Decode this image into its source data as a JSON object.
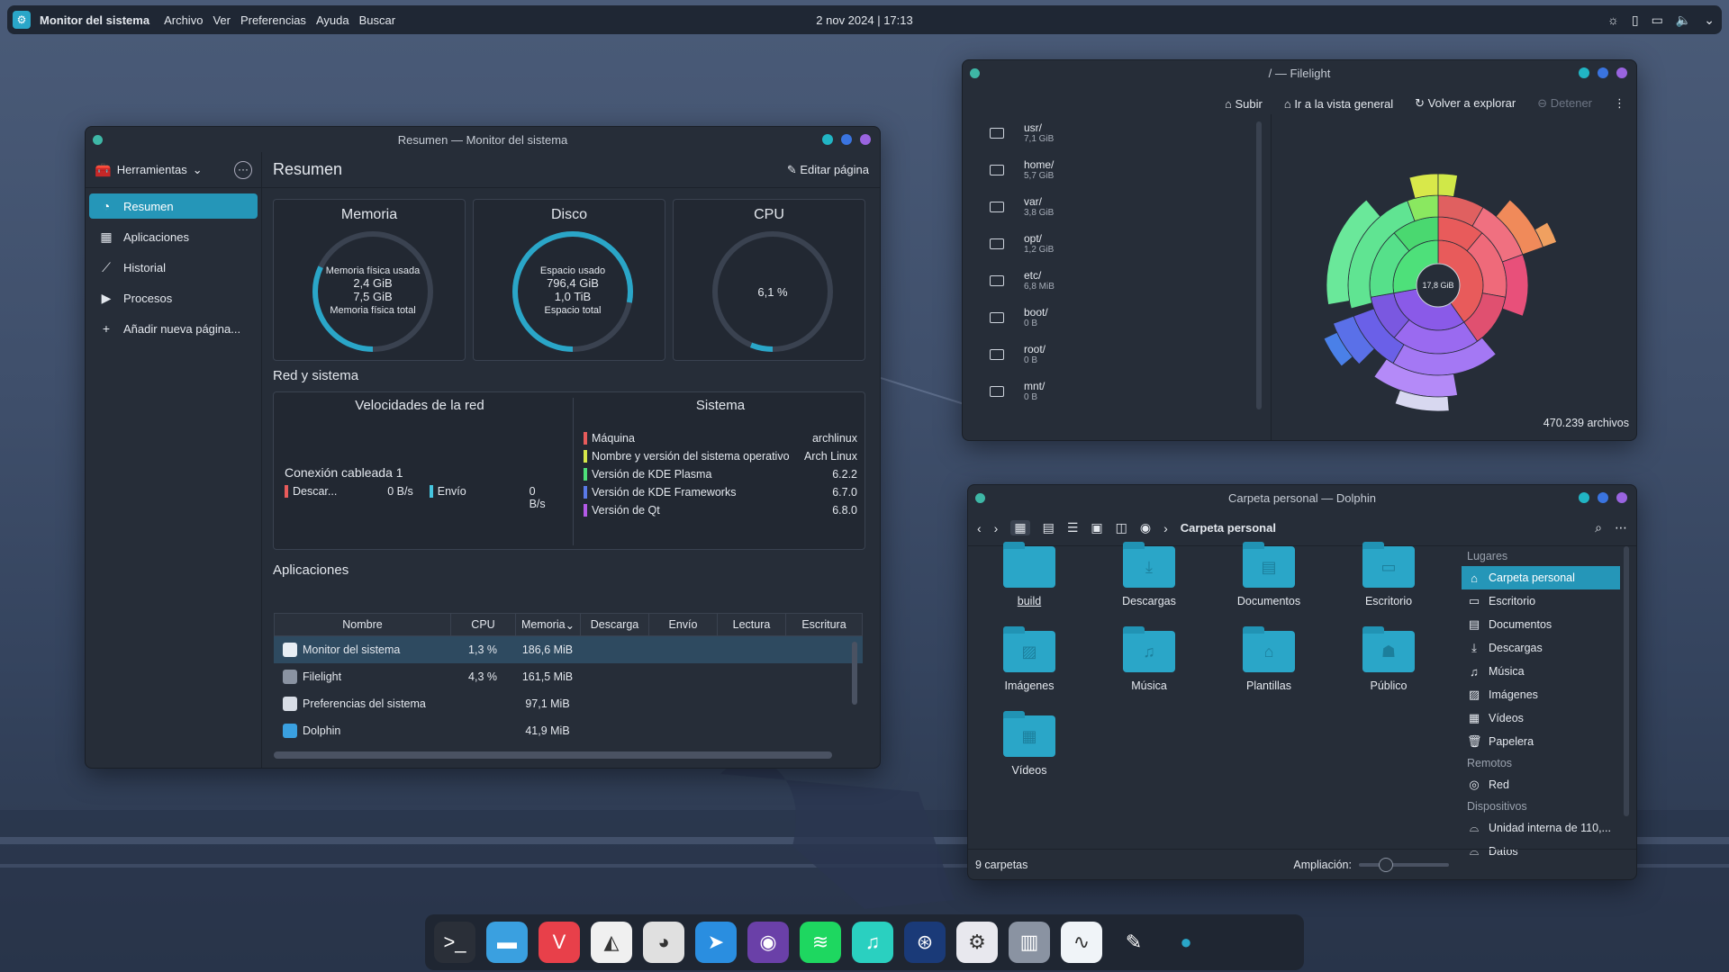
{
  "panel": {
    "app_name": "Monitor del sistema",
    "menu": [
      "Archivo",
      "Ver",
      "Preferencias",
      "Ayuda",
      "Buscar"
    ],
    "clock": "2 nov 2024 | 17:13"
  },
  "sysmon": {
    "title": "Resumen — Monitor del sistema",
    "tools_label": "Herramientas",
    "nav": [
      {
        "label": "Resumen",
        "icon": "gauge-icon"
      },
      {
        "label": "Aplicaciones",
        "icon": "grid-icon"
      },
      {
        "label": "Historial",
        "icon": "chart-icon"
      },
      {
        "label": "Procesos",
        "icon": "play-icon"
      },
      {
        "label": "Añadir nueva página...",
        "icon": "plus-icon"
      }
    ],
    "page_title": "Resumen",
    "edit_label": "Editar página",
    "memory": {
      "title": "Memoria",
      "used_label": "Memoria física usada",
      "used": "2,4 GiB",
      "total": "7,5 GiB",
      "total_label": "Memoria física total",
      "fraction": 0.32
    },
    "disk": {
      "title": "Disco",
      "used_label": "Espacio usado",
      "used": "796,4 GiB",
      "total": "1,0 TiB",
      "total_label": "Espacio total",
      "fraction": 0.78
    },
    "cpu": {
      "title": "CPU",
      "value": "6,1 %",
      "fraction": 0.061
    },
    "net_section": "Red y sistema",
    "net": {
      "title": "Velocidades de la red",
      "conn": "Conexión cableada 1",
      "down_label": "Descar...",
      "down_val": "0 B/s",
      "up_label": "Envío",
      "up_val": "0 B/s",
      "down_color": "#e85b5b",
      "up_color": "#46c6e0"
    },
    "system": {
      "title": "Sistema",
      "rows": [
        {
          "k": "Máquina",
          "v": "archlinux",
          "c": "#e85b5b"
        },
        {
          "k": "Nombre y versión del sistema operativo",
          "v": "Arch Linux",
          "c": "#d7e84a"
        },
        {
          "k": "Versión de KDE Plasma",
          "v": "6.2.2",
          "c": "#4ee07a"
        },
        {
          "k": "Versión de KDE Frameworks",
          "v": "6.7.0",
          "c": "#5a7ae8"
        },
        {
          "k": "Versión de Qt",
          "v": "6.8.0",
          "c": "#b45ae8"
        }
      ]
    },
    "apps_section": "Aplicaciones",
    "columns": [
      "Nombre",
      "CPU",
      "Memoria",
      "Descarga",
      "Envío",
      "Lectura",
      "Escritura"
    ],
    "rows": [
      {
        "name": "Monitor del sistema",
        "cpu": "1,3 %",
        "mem": "186,6 MiB"
      },
      {
        "name": "Filelight",
        "cpu": "4,3 %",
        "mem": "161,5 MiB"
      },
      {
        "name": "Preferencias del sistema",
        "cpu": "",
        "mem": "97,1 MiB"
      },
      {
        "name": "Dolphin",
        "cpu": "",
        "mem": "41,9 MiB"
      }
    ]
  },
  "filelight": {
    "title": "/ — Filelight",
    "toolbar": [
      "Subir",
      "Ir a la vista general",
      "Volver a explorar",
      "Detener"
    ],
    "items": [
      {
        "n": "usr/",
        "s": "7,1 GiB"
      },
      {
        "n": "home/",
        "s": "5,7 GiB"
      },
      {
        "n": "var/",
        "s": "3,8 GiB"
      },
      {
        "n": "opt/",
        "s": "1,2 GiB"
      },
      {
        "n": "etc/",
        "s": "6,8 MiB"
      },
      {
        "n": "boot/",
        "s": "0 B"
      },
      {
        "n": "root/",
        "s": "0 B"
      },
      {
        "n": "mnt/",
        "s": "0 B"
      }
    ],
    "center": "17,8 GiB",
    "files": "470.239 archivos"
  },
  "dolphin": {
    "title": "Carpeta personal — Dolphin",
    "crumb": "Carpeta personal",
    "folders": [
      "build",
      "Descargas",
      "Documentos",
      "Escritorio",
      "Imágenes",
      "Música",
      "Plantillas",
      "Público",
      "Vídeos"
    ],
    "places_hd": "Lugares",
    "places": [
      "Carpeta personal",
      "Escritorio",
      "Documentos",
      "Descargas",
      "Música",
      "Imágenes",
      "Vídeos",
      "Papelera"
    ],
    "remote_hd": "Remotos",
    "remote": "Red",
    "dev_hd": "Dispositivos",
    "devices": [
      "Unidad interna de 110,...",
      "Datos"
    ],
    "status": "9 carpetas",
    "zoom": "Ampliación:"
  },
  "dock": [
    "terminal",
    "files",
    "vivaldi",
    "inkscape",
    "gimp",
    "kdeconnect",
    "tor",
    "spotify",
    "music",
    "steam",
    "settings",
    "disk",
    "monitor",
    "color-picker",
    "dot"
  ]
}
